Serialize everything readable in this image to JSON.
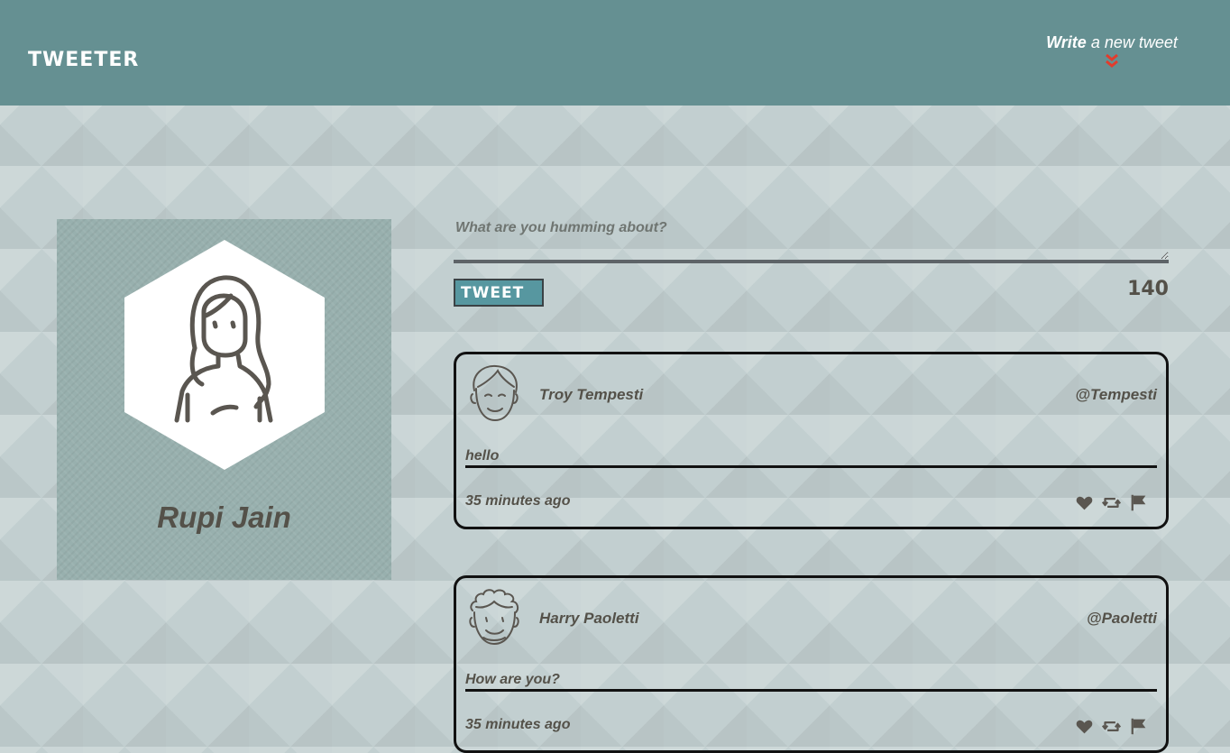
{
  "header": {
    "brand": "TWEETER",
    "compose_toggle_strong": "Write",
    "compose_toggle_rest": " a new tweet",
    "compose_toggle_icon": "double-chevron-down-icon",
    "chevron_color": "#e23c2c"
  },
  "profile": {
    "name": "Rupi Jain",
    "avatar_icon": "woman-avatar-icon"
  },
  "compose": {
    "placeholder": "What are you humming about?",
    "button_label": "TWEET",
    "char_counter": "140"
  },
  "tweets": [
    {
      "author": "Troy Tempesti",
      "handle": "@Tempesti",
      "text": "hello",
      "time": "35 minutes ago",
      "avatar_icon": "boy-avatar-icon"
    },
    {
      "author": "Harry Paoletti",
      "handle": "@Paoletti",
      "text": "How are you?",
      "time": "35 minutes ago",
      "avatar_icon": "curly-hair-avatar-icon"
    }
  ],
  "tweet_actions": [
    "heart-icon",
    "retweet-icon",
    "flag-icon"
  ],
  "colors": {
    "header_bg": "#659092",
    "page_bg": "#c2cfd0",
    "profile_bg": "#98b0ae",
    "button_bg": "#5797a0",
    "text": "#545149"
  }
}
